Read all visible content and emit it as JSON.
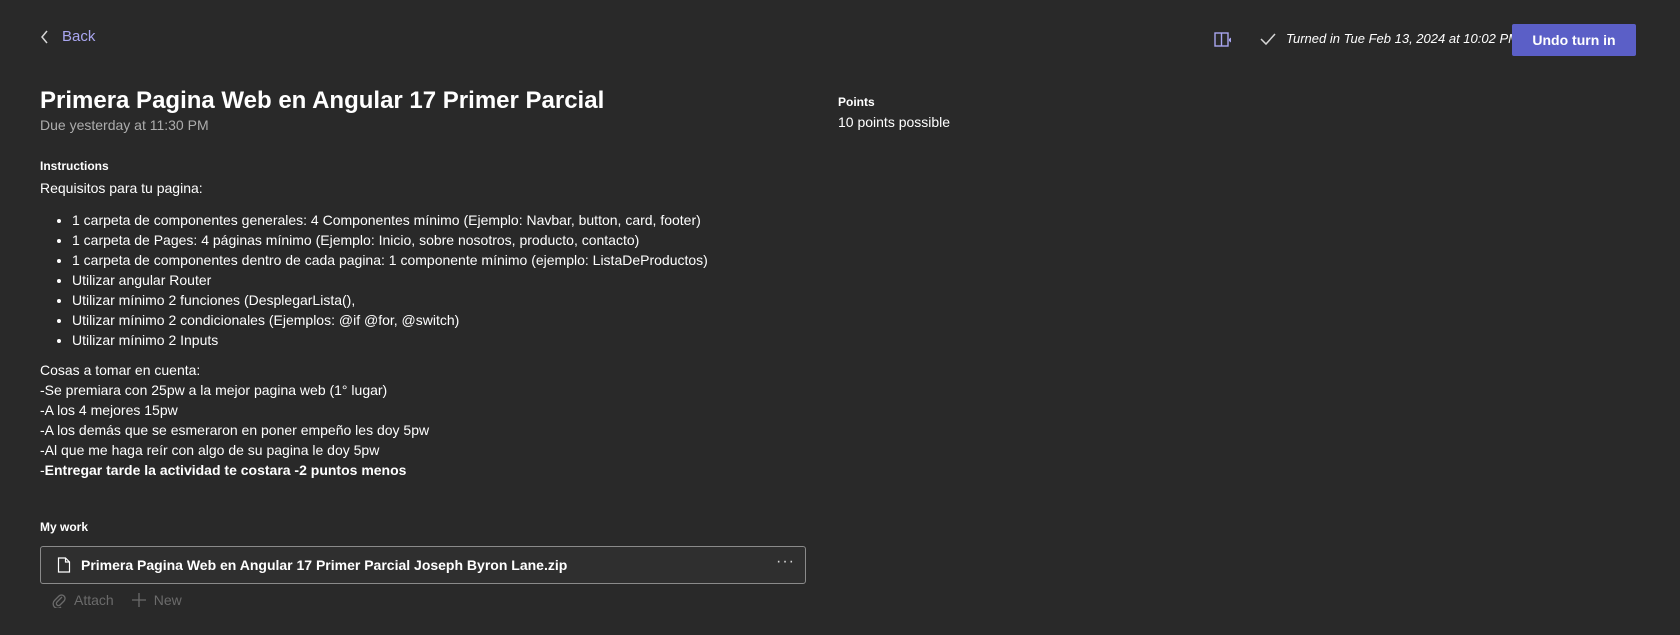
{
  "header": {
    "back_label": "Back",
    "turned_in_text": "Turned in Tue Feb 13, 2024 at 10:02 PM",
    "undo_label": "Undo turn in"
  },
  "assignment": {
    "title": "Primera Pagina Web en Angular 17 Primer Parcial",
    "due": "Due yesterday at 11:30 PM",
    "instructions_label": "Instructions",
    "intro": "Requisitos para tu pagina:",
    "requirements": [
      "1 carpeta de componentes generales: 4 Componentes mínimo (Ejemplo: Navbar, button, card, footer)",
      "1 carpeta de Pages: 4 páginas mínimo (Ejemplo: Inicio, sobre nosotros, producto, contacto)",
      "1 carpeta de componentes dentro de cada pagina: 1 componente mínimo (ejemplo: ListaDeProductos)",
      "Utilizar angular Router",
      "Utilizar mínimo 2 funciones (DesplegarLista(),",
      "Utilizar mínimo 2 condicionales (Ejemplos: @if  @for, @switch)",
      "Utilizar mínimo 2 Inputs"
    ],
    "notes": [
      "Cosas a  tomar en cuenta:",
      "-Se premiara con 25pw a la mejor pagina web (1° lugar)",
      "-A los 4 mejores 15pw",
      "-A los demás que se esmeraron en poner empeño les doy 5pw",
      "-Al que me haga reír con algo de su pagina le doy 5pw"
    ],
    "final_note_prefix": "-",
    "final_note_bold": "Entregar tarde la actividad te costara -2 puntos menos"
  },
  "points": {
    "label": "Points",
    "value": "10 points possible"
  },
  "my_work": {
    "label": "My work",
    "file_name": "Primera Pagina Web en Angular 17 Primer Parcial Joseph Byron Lane.zip",
    "more_label": "···",
    "attach_label": "Attach",
    "new_label": "New"
  },
  "colors": {
    "background": "#292929",
    "accent": "#5b5fc7",
    "link": "#a9a6f0"
  },
  "icons": [
    "chevron-left-icon",
    "immersive-reader-icon",
    "checkmark-icon",
    "file-icon",
    "more-icon",
    "paperclip-icon",
    "plus-icon"
  ]
}
